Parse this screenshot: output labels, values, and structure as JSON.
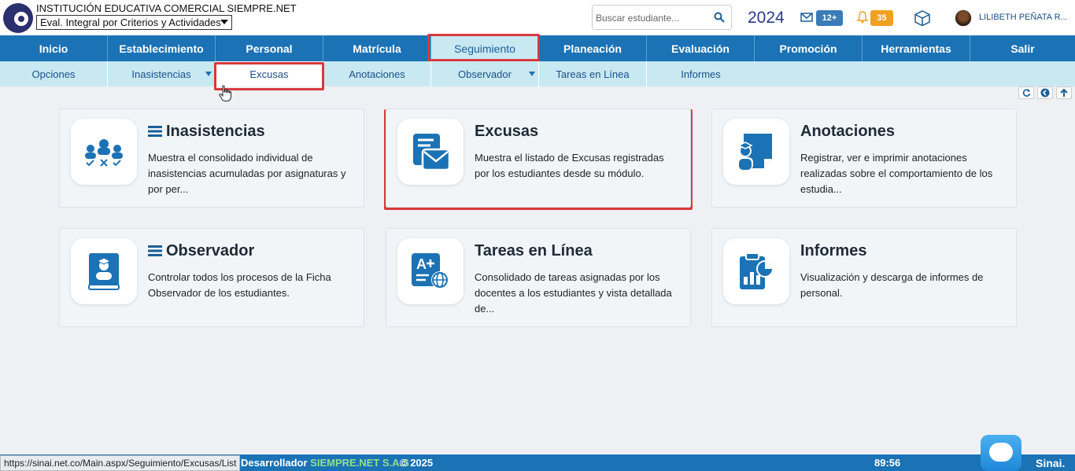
{
  "header": {
    "school_name": "INSTITUCIÓN EDUCATIVA COMERCIAL SIEMPRE.NET",
    "eval_selected": "Eval. Integral por Criterios y Actividades",
    "search_placeholder": "Buscar estudiante...",
    "year": "2024",
    "mail_count": "12+",
    "notif_count": "35",
    "user_name": "LILIBETH PEÑATA R...",
    "colors": {
      "mail_badge": "#3a7cb8",
      "notif_badge": "#f0a020"
    }
  },
  "main_nav": [
    {
      "label": "Inicio",
      "active": false
    },
    {
      "label": "Establecimiento",
      "active": false
    },
    {
      "label": "Personal",
      "active": false
    },
    {
      "label": "Matrícula",
      "active": false
    },
    {
      "label": "Seguimiento",
      "active": true
    },
    {
      "label": "Planeación",
      "active": false
    },
    {
      "label": "Evaluación",
      "active": false
    },
    {
      "label": "Promoción",
      "active": false
    },
    {
      "label": "Herramientas",
      "active": false
    },
    {
      "label": "Salir",
      "active": false
    }
  ],
  "sub_nav": [
    {
      "label": "Opciones",
      "dropdown": false,
      "active": false
    },
    {
      "label": "Inasistencias",
      "dropdown": true,
      "active": false
    },
    {
      "label": "Excusas",
      "dropdown": false,
      "active": true
    },
    {
      "label": "Anotaciones",
      "dropdown": false,
      "active": false
    },
    {
      "label": "Observador",
      "dropdown": true,
      "active": false
    },
    {
      "label": "Tareas en Línea",
      "dropdown": false,
      "active": false
    },
    {
      "label": "Informes",
      "dropdown": false,
      "active": false
    }
  ],
  "cards": [
    {
      "title": "Inasistencias",
      "icon": "students-attendance-icon",
      "menu": true,
      "desc": "Muestra el consolidado individual de inasistencias acumuladas por asignaturas y por per..."
    },
    {
      "title": "Excusas",
      "icon": "excuse-mail-icon",
      "menu": false,
      "desc": "Muestra el listado de Excusas registradas por los estudiantes desde su módulo."
    },
    {
      "title": "Anotaciones",
      "icon": "student-note-icon",
      "menu": false,
      "desc": "Registrar, ver e imprimir anotaciones realizadas sobre el comportamiento de los estudia..."
    },
    {
      "title": "Observador",
      "icon": "observer-book-icon",
      "menu": true,
      "desc": "Controlar todos los procesos de la Ficha Observador de los estudiantes."
    },
    {
      "title": "Tareas en Línea",
      "icon": "online-tasks-icon",
      "menu": false,
      "desc": "Consolidado de tareas asignadas por los docentes a los estudiantes y vista detallada de..."
    },
    {
      "title": "Informes",
      "icon": "reports-clipboard-icon",
      "menu": false,
      "desc": "Visualización y descarga de informes de personal."
    }
  ],
  "footer": {
    "status_url": "https://sinai.net.co/Main.aspx/Seguimiento/Excusas/List",
    "dev_label": "Desarrollador",
    "dev_brand": "SIEMPRE.NET S.A.S",
    "copyright": "© 2025",
    "timer": "89:56",
    "logo_text": "Sinai."
  },
  "accent_color": "#1b72b4",
  "highlight_color": "#d9393c"
}
